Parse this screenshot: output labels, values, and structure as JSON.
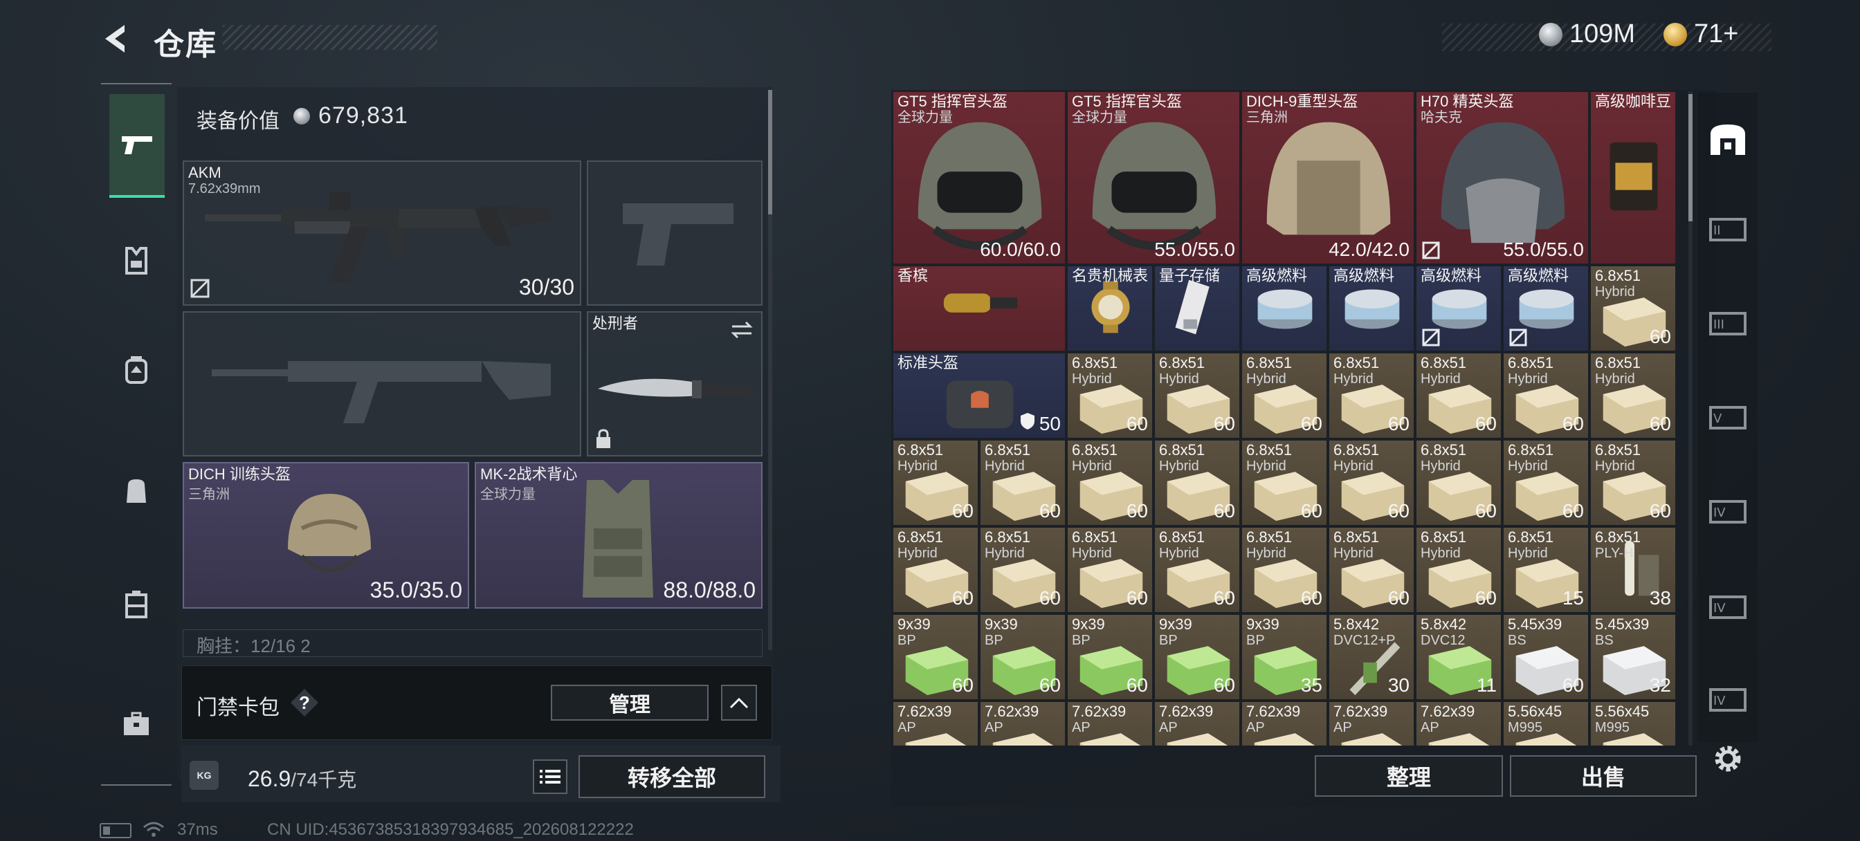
{
  "header": {
    "title": "仓库",
    "currency_silver": "109M",
    "currency_gold": "71+"
  },
  "loadout": {
    "equip_value_label": "装备价值",
    "equip_value": "679,831",
    "primary": {
      "name": "AKM",
      "caliber": "7.62x39mm",
      "ammo": "30/30"
    },
    "melee": {
      "name": "处刑者"
    },
    "helmet": {
      "name": "DICH 训练头盔",
      "maker": "三角洲",
      "durability": "35.0/35.0"
    },
    "armor": {
      "name": "MK-2战术背心",
      "maker": "全球力量",
      "durability": "88.0/88.0"
    },
    "chest_rig_partial": "胸挂：12/16  2",
    "gatecard_label": "门禁卡包",
    "manage_label": "管理",
    "weight_current": "26.9",
    "weight_max": "/74千克",
    "weight_icon_text": "KG",
    "transfer_all_label": "转移全部"
  },
  "inventory": {
    "rows": [
      [
        {
          "name": "GT5 指挥官头盔",
          "sub": "全球力量",
          "val": "60.0/60.0",
          "bg": "red",
          "kind": "helmet-dark"
        },
        {
          "name": "GT5 指挥官头盔",
          "sub": "全球力量",
          "val": "55.0/55.0",
          "bg": "red",
          "kind": "helmet-dark"
        },
        {
          "name": "DICH-9重型头盔",
          "sub": "三角洲",
          "val": "42.0/42.0",
          "bg": "red",
          "kind": "helmet-tan"
        },
        {
          "name": "H70 精英头盔",
          "sub": "哈夫克",
          "val": "55.0/55.0",
          "bg": "red",
          "kind": "helmet-grey",
          "locked": true
        },
        {
          "name": "高级咖啡豆",
          "sub": "",
          "val": "",
          "bg": "red",
          "kind": "coffee"
        }
      ],
      [
        {
          "name": "香槟",
          "sub": "",
          "val": "",
          "bg": "red",
          "kind": "bottle"
        },
        {
          "name": "名贵机械表",
          "sub": "",
          "val": "",
          "bg": "navy",
          "kind": "watch"
        },
        {
          "name": "量子存储",
          "sub": "",
          "val": "",
          "bg": "navy",
          "kind": "drive"
        },
        {
          "name": "高级燃料",
          "sub": "",
          "val": "",
          "bg": "navy",
          "kind": "fuel"
        },
        {
          "name": "高级燃料",
          "sub": "",
          "val": "",
          "bg": "navy",
          "kind": "fuel"
        },
        {
          "name": "高级燃料",
          "sub": "",
          "val": "",
          "bg": "navy",
          "kind": "fuel",
          "locked": true
        },
        {
          "name": "高级燃料",
          "sub": "",
          "val": "",
          "bg": "navy",
          "kind": "fuel",
          "locked": true
        },
        {
          "name": "6.8x51",
          "sub": "Hybrid",
          "val": "60",
          "bg": "olive",
          "kind": "ammo-tan"
        }
      ],
      [
        {
          "name": "标准头盔",
          "sub": "",
          "val": "50",
          "bg": "navy",
          "kind": "bag",
          "shield": true
        },
        {
          "name": "6.8x51",
          "sub": "Hybrid",
          "val": "60",
          "bg": "olive",
          "kind": "ammo-tan"
        },
        {
          "name": "6.8x51",
          "sub": "Hybrid",
          "val": "60",
          "bg": "olive",
          "kind": "ammo-tan"
        },
        {
          "name": "6.8x51",
          "sub": "Hybrid",
          "val": "60",
          "bg": "olive",
          "kind": "ammo-tan"
        },
        {
          "name": "6.8x51",
          "sub": "Hybrid",
          "val": "60",
          "bg": "olive",
          "kind": "ammo-tan"
        },
        {
          "name": "6.8x51",
          "sub": "Hybrid",
          "val": "60",
          "bg": "olive",
          "kind": "ammo-tan"
        },
        {
          "name": "6.8x51",
          "sub": "Hybrid",
          "val": "60",
          "bg": "olive",
          "kind": "ammo-tan"
        },
        {
          "name": "6.8x51",
          "sub": "Hybrid",
          "val": "60",
          "bg": "olive",
          "kind": "ammo-tan"
        }
      ],
      [
        {
          "name": "6.8x51",
          "sub": "Hybrid",
          "val": "60",
          "bg": "olive",
          "kind": "ammo-tan"
        },
        {
          "name": "6.8x51",
          "sub": "Hybrid",
          "val": "60",
          "bg": "olive",
          "kind": "ammo-tan"
        },
        {
          "name": "6.8x51",
          "sub": "Hybrid",
          "val": "60",
          "bg": "olive",
          "kind": "ammo-tan"
        },
        {
          "name": "6.8x51",
          "sub": "Hybrid",
          "val": "60",
          "bg": "olive",
          "kind": "ammo-tan"
        },
        {
          "name": "6.8x51",
          "sub": "Hybrid",
          "val": "60",
          "bg": "olive",
          "kind": "ammo-tan"
        },
        {
          "name": "6.8x51",
          "sub": "Hybrid",
          "val": "60",
          "bg": "olive",
          "kind": "ammo-tan"
        },
        {
          "name": "6.8x51",
          "sub": "Hybrid",
          "val": "60",
          "bg": "olive",
          "kind": "ammo-tan"
        },
        {
          "name": "6.8x51",
          "sub": "Hybrid",
          "val": "60",
          "bg": "olive",
          "kind": "ammo-tan"
        },
        {
          "name": "6.8x51",
          "sub": "Hybrid",
          "val": "60",
          "bg": "olive",
          "kind": "ammo-tan"
        }
      ],
      [
        {
          "name": "6.8x51",
          "sub": "Hybrid",
          "val": "60",
          "bg": "olive",
          "kind": "ammo-tan"
        },
        {
          "name": "6.8x51",
          "sub": "Hybrid",
          "val": "60",
          "bg": "olive",
          "kind": "ammo-tan"
        },
        {
          "name": "6.8x51",
          "sub": "Hybrid",
          "val": "60",
          "bg": "olive",
          "kind": "ammo-tan"
        },
        {
          "name": "6.8x51",
          "sub": "Hybrid",
          "val": "60",
          "bg": "olive",
          "kind": "ammo-tan"
        },
        {
          "name": "6.8x51",
          "sub": "Hybrid",
          "val": "60",
          "bg": "olive",
          "kind": "ammo-tan"
        },
        {
          "name": "6.8x51",
          "sub": "Hybrid",
          "val": "60",
          "bg": "olive",
          "kind": "ammo-tan"
        },
        {
          "name": "6.8x51",
          "sub": "Hybrid",
          "val": "60",
          "bg": "olive",
          "kind": "ammo-tan"
        },
        {
          "name": "6.8x51",
          "sub": "Hybrid",
          "val": "15",
          "bg": "olive",
          "kind": "ammo-tan"
        },
        {
          "name": "6.8x51",
          "sub": "PLY-H",
          "val": "38",
          "bg": "olive",
          "kind": "ammo-round"
        }
      ],
      [
        {
          "name": "9x39",
          "sub": "BP",
          "val": "60",
          "bg": "olive",
          "kind": "ammo-green"
        },
        {
          "name": "9x39",
          "sub": "BP",
          "val": "60",
          "bg": "olive",
          "kind": "ammo-green"
        },
        {
          "name": "9x39",
          "sub": "BP",
          "val": "60",
          "bg": "olive",
          "kind": "ammo-green"
        },
        {
          "name": "9x39",
          "sub": "BP",
          "val": "60",
          "bg": "olive",
          "kind": "ammo-green"
        },
        {
          "name": "9x39",
          "sub": "BP",
          "val": "35",
          "bg": "olive",
          "kind": "ammo-green"
        },
        {
          "name": "5.8x42",
          "sub": "DVC12+P",
          "val": "30",
          "bg": "olive",
          "kind": "ammo-stick"
        },
        {
          "name": "5.8x42",
          "sub": "DVC12",
          "val": "11",
          "bg": "olive",
          "kind": "ammo-green"
        },
        {
          "name": "5.45x39",
          "sub": "BS",
          "val": "60",
          "bg": "olive",
          "kind": "ammo-white"
        },
        {
          "name": "5.45x39",
          "sub": "BS",
          "val": "32",
          "bg": "olive",
          "kind": "ammo-white"
        }
      ],
      [
        {
          "name": "7.62x39",
          "sub": "AP",
          "val": "",
          "bg": "olive",
          "kind": "ammo-tan"
        },
        {
          "name": "7.62x39",
          "sub": "AP",
          "val": "",
          "bg": "olive",
          "kind": "ammo-tan"
        },
        {
          "name": "7.62x39",
          "sub": "AP",
          "val": "",
          "bg": "olive",
          "kind": "ammo-tan"
        },
        {
          "name": "7.62x39",
          "sub": "AP",
          "val": "",
          "bg": "olive",
          "kind": "ammo-tan"
        },
        {
          "name": "7.62x39",
          "sub": "AP",
          "val": "",
          "bg": "olive",
          "kind": "ammo-tan"
        },
        {
          "name": "7.62x39",
          "sub": "AP",
          "val": "",
          "bg": "olive",
          "kind": "ammo-tan"
        },
        {
          "name": "7.62x39",
          "sub": "AP",
          "val": "",
          "bg": "olive",
          "kind": "ammo-tan"
        },
        {
          "name": "5.56x45",
          "sub": "M995",
          "val": "",
          "bg": "olive",
          "kind": "ammo-tan"
        },
        {
          "name": "5.56x45",
          "sub": "M995",
          "val": "",
          "bg": "olive",
          "kind": "ammo-tan"
        }
      ]
    ],
    "sort_label": "整理",
    "sell_label": "出售",
    "rail_tiers": [
      "II",
      "III",
      "V",
      "IV",
      "IV",
      "IV"
    ]
  },
  "status_bar": {
    "ping": "37ms",
    "uid": "CN UID:45367385318397934685_202608122222"
  },
  "colors": {
    "accent_green": "#38e0a8",
    "cell_red": "#6a2a33",
    "cell_navy": "#2e3552",
    "cell_olive": "#5c5140"
  }
}
